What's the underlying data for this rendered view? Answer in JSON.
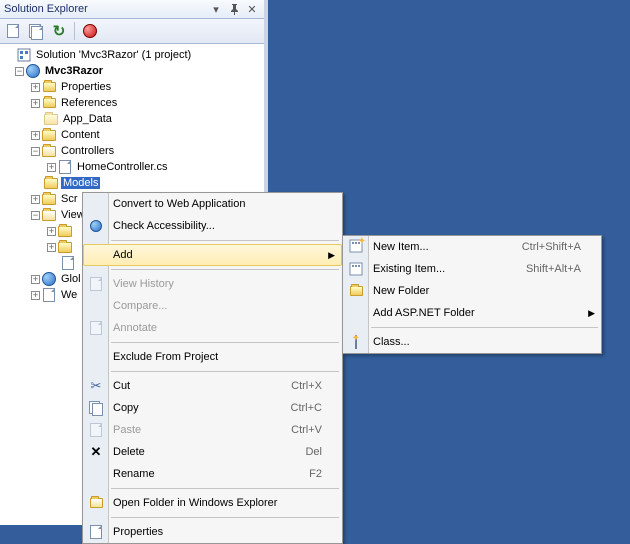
{
  "panel": {
    "title": "Solution Explorer"
  },
  "tree": {
    "solution": "Solution 'Mvc3Razor' (1 project)",
    "project": "Mvc3Razor",
    "properties": "Properties",
    "references": "References",
    "appdata": "App_Data",
    "content": "Content",
    "controllers": "Controllers",
    "homecontroller": "HomeController.cs",
    "models": "Models",
    "scripts": "Scr",
    "views": "View",
    "global": "Glol",
    "webconfig": "We"
  },
  "menu1": {
    "convert": "Convert to Web Application",
    "check": "Check Accessibility...",
    "add": "Add",
    "history": "View History",
    "compare": "Compare...",
    "annotate": "Annotate",
    "exclude": "Exclude From Project",
    "cut": "Cut",
    "cut_sh": "Ctrl+X",
    "copy": "Copy",
    "copy_sh": "Ctrl+C",
    "paste": "Paste",
    "paste_sh": "Ctrl+V",
    "delete": "Delete",
    "delete_sh": "Del",
    "rename": "Rename",
    "rename_sh": "F2",
    "open": "Open Folder in Windows Explorer",
    "props": "Properties"
  },
  "menu2": {
    "newitem": "New Item...",
    "newitem_sh": "Ctrl+Shift+A",
    "existing": "Existing Item...",
    "existing_sh": "Shift+Alt+A",
    "newfolder": "New Folder",
    "aspfolder": "Add ASP.NET Folder",
    "class": "Class..."
  }
}
